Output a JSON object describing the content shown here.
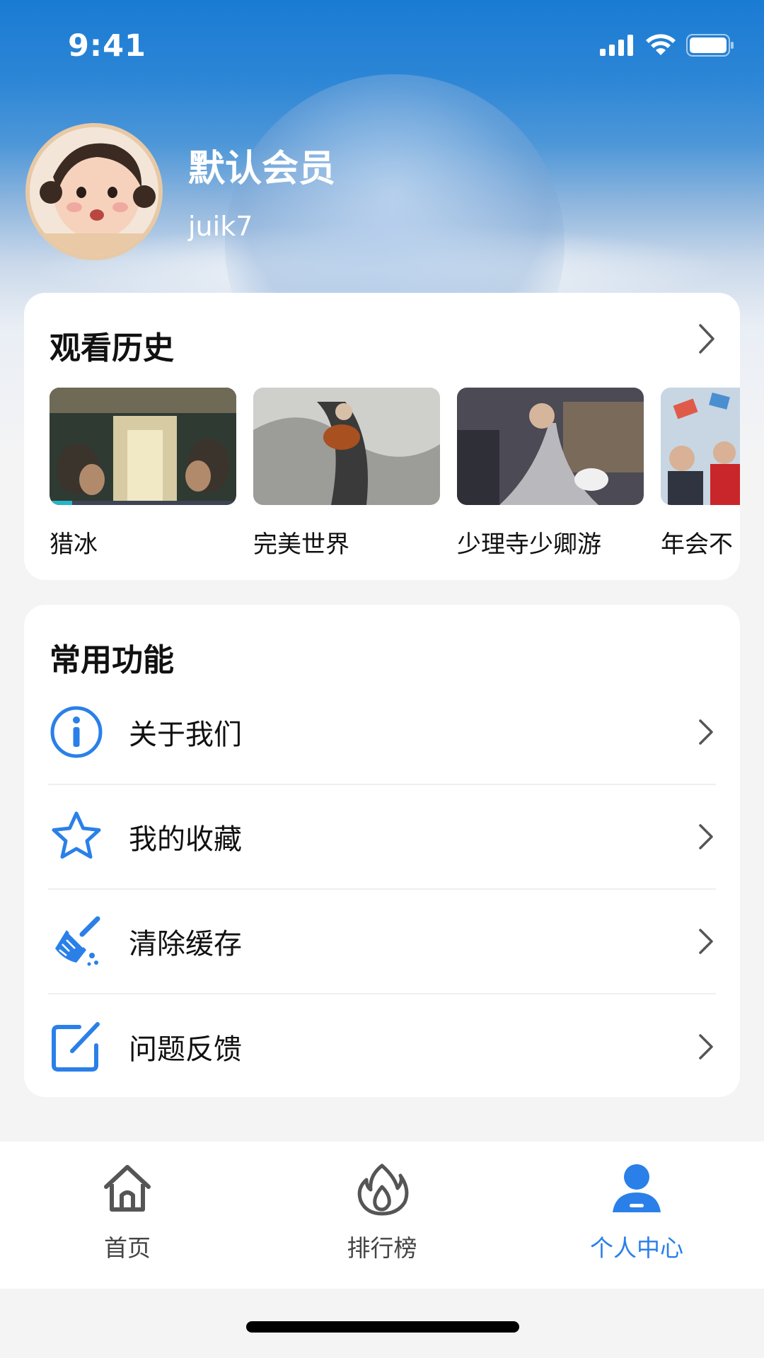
{
  "status_bar": {
    "time": "9:41"
  },
  "profile": {
    "name": "默认会员",
    "user_id": "juik7"
  },
  "history": {
    "title": "观看历史",
    "items": [
      {
        "title": "猎冰",
        "progress": 0.12
      },
      {
        "title": "完美世界"
      },
      {
        "title": "少理寺少卿游"
      },
      {
        "title": "年会不"
      }
    ]
  },
  "functions": {
    "title": "常用功能",
    "items": [
      {
        "label": "关于我们",
        "icon": "info-icon"
      },
      {
        "label": "我的收藏",
        "icon": "star-icon"
      },
      {
        "label": "清除缓存",
        "icon": "broom-icon"
      },
      {
        "label": "问题反馈",
        "icon": "edit-icon"
      }
    ]
  },
  "tabbar": {
    "items": [
      {
        "label": "首页",
        "icon": "home-icon"
      },
      {
        "label": "排行榜",
        "icon": "fire-icon"
      },
      {
        "label": "个人中心",
        "icon": "user-icon",
        "active": true
      }
    ]
  },
  "colors": {
    "accent": "#2a80e8",
    "hero_top": "#1a7bd3",
    "page_bg": "#f4f4f5"
  }
}
